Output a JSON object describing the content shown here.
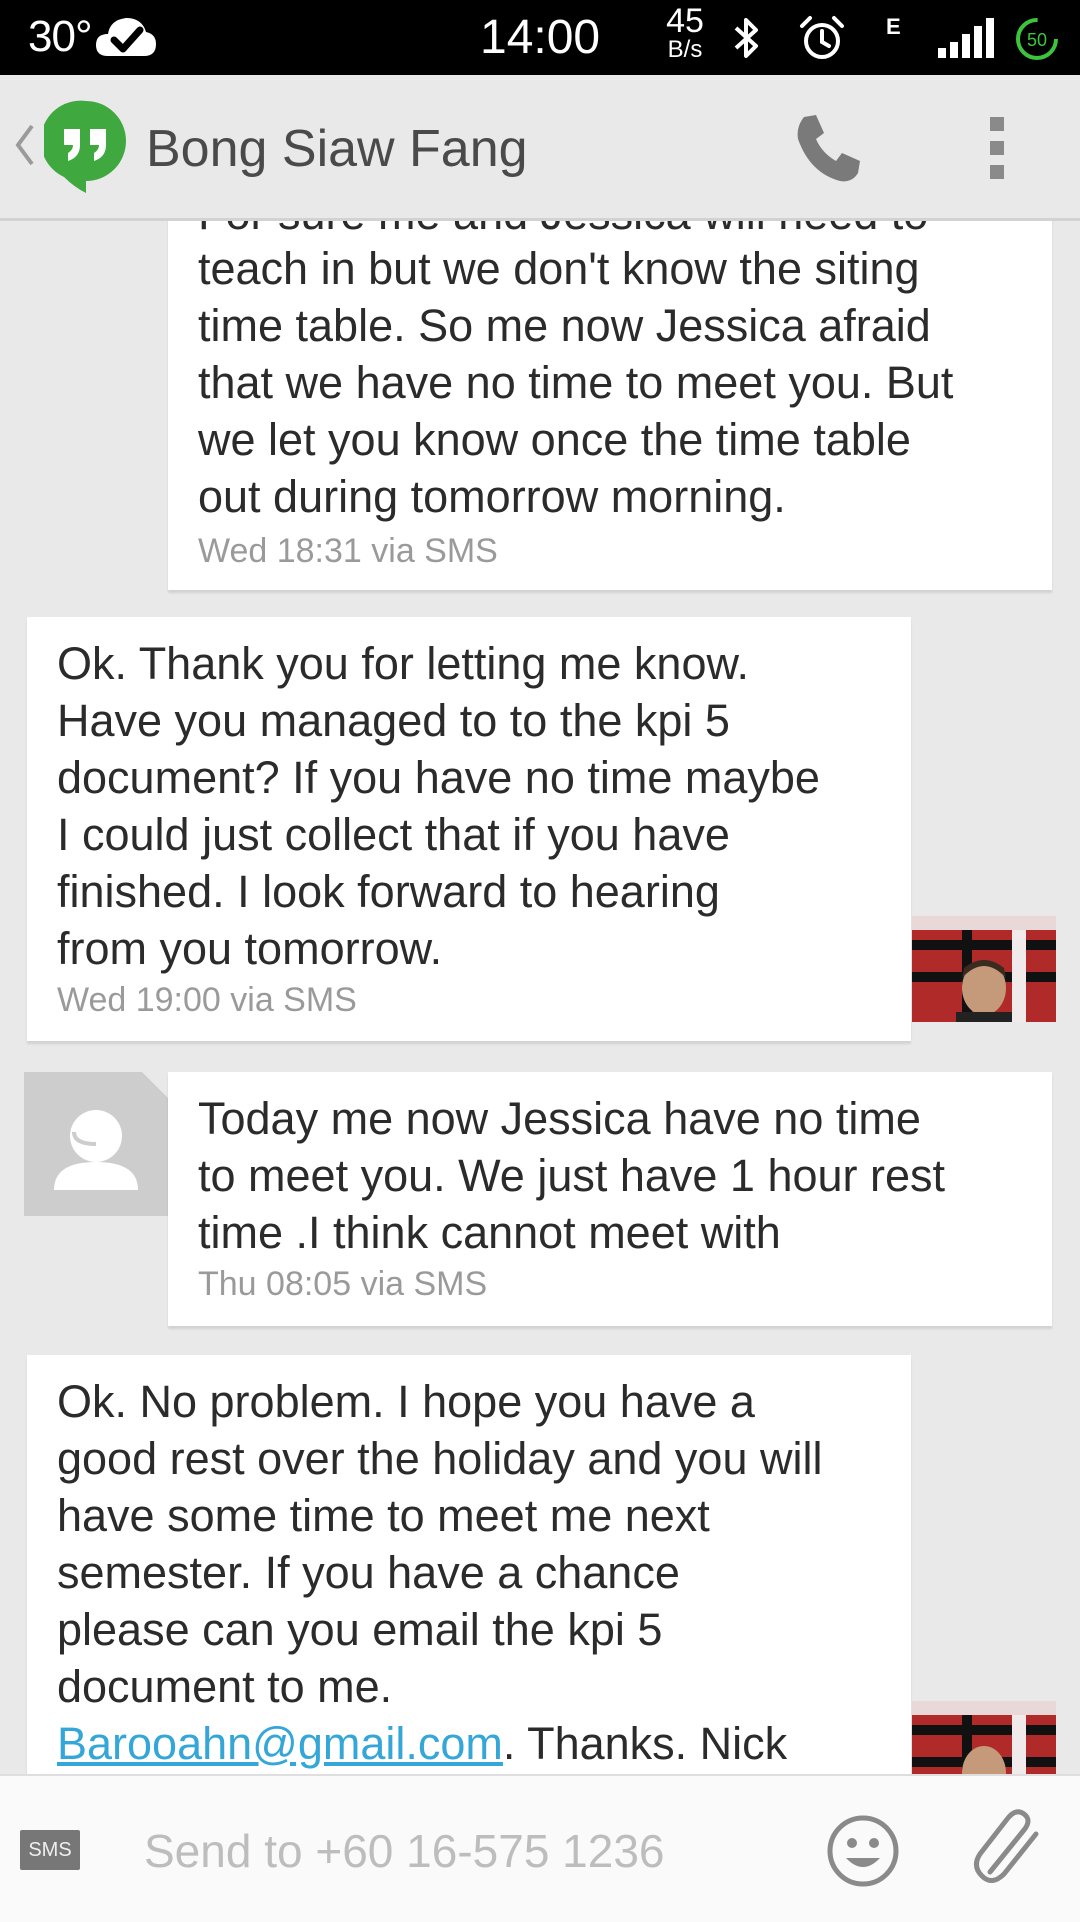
{
  "status_bar": {
    "temperature": "30°",
    "time": "14:00",
    "net_speed_value": "45",
    "net_speed_unit": "B/s",
    "network_type": "E",
    "battery_level": "50",
    "icons": [
      "weather-cloud-check-icon",
      "bluetooth-icon",
      "alarm-icon",
      "signal-icon",
      "battery-icon"
    ]
  },
  "action_bar": {
    "title": "Bong Siaw Fang",
    "icons": [
      "back-chevron-icon",
      "hangouts-logo-icon",
      "call-icon",
      "overflow-menu-icon"
    ]
  },
  "messages": [
    {
      "direction": "incoming",
      "text_top_partial": "For sure me and Jessica will need to",
      "text": "teach in but we don't know the siting\ntime table.  So me now Jessica afraid\nthat we have no time to meet you.  But\nwe let you know once the time table\nout during tomorrow morning.",
      "meta": "Wed 18:31 via SMS"
    },
    {
      "direction": "outgoing",
      "text": "Ok.  Thank you for letting me know.\nHave you managed to to the kpi 5\ndocument? If you have no time maybe\nI could just collect that if you have\nfinished.  I look forward  to hearing\nfrom you tomorrow.",
      "meta": "Wed 19:00 via SMS"
    },
    {
      "direction": "incoming",
      "text": "Today me now Jessica have no time\nto meet you.  We just have 1 hour rest\ntime .I think cannot meet with",
      "meta": "Thu 08:05 via SMS"
    },
    {
      "direction": "outgoing",
      "text": "Ok.  No problem.  I hope you have a\ngood rest over the holiday and you will\nhave some time to meet me next\nsemester.   If you have a chance\nplease can you email the kpi 5\ndocument to me.",
      "link": "Barooahn@gmail.com",
      "after_link": ".  Thanks.  Nick"
    }
  ],
  "compose": {
    "badge": "SMS",
    "placeholder": "Send to +60 16-575 1236"
  },
  "colors": {
    "background": "#e9e9e9",
    "bubble": "#ffffff",
    "link": "#34a7d8",
    "hangouts_green": "#3fa93f",
    "battery_green": "#3cc43c"
  }
}
